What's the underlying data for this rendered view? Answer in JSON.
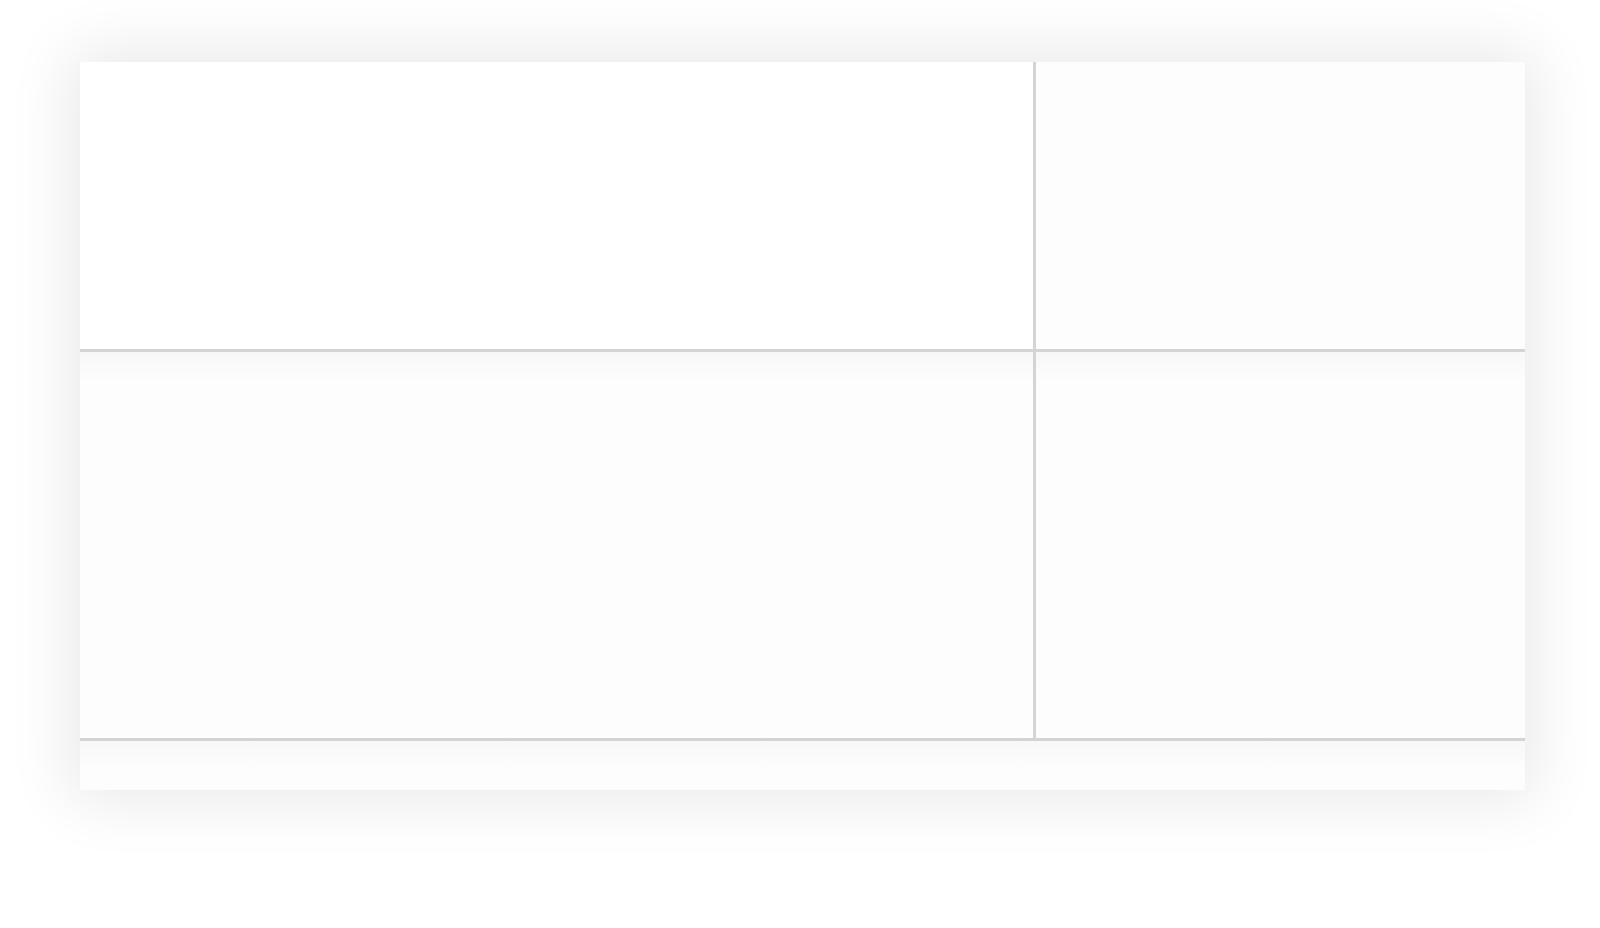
{
  "layout": {
    "rows": 3,
    "columns": 2
  },
  "cells": {
    "top_left": {
      "text": ""
    },
    "top_right": {
      "text": ""
    },
    "middle_left": {
      "text": ""
    },
    "middle_right": {
      "text": ""
    },
    "bottom_strip": {
      "text": ""
    }
  },
  "colors": {
    "background": "#ffffff",
    "panel": "#ffffff",
    "divider": "#d4d4d4"
  }
}
